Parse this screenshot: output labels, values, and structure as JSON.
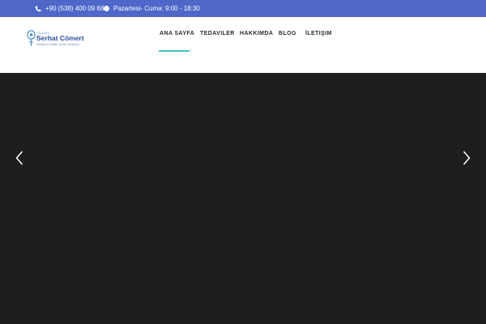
{
  "topbar": {
    "phone": "+90 (538) 400 09 68",
    "hours": "Pazartesi- Cuma: 9:00 - 18:30",
    "background": "#4e67c9"
  },
  "logo": {
    "small": "OLUDU",
    "name": "Serhat Cömert",
    "tagline": "Medikal ve Estetik Cerrahi Teknisyeni"
  },
  "nav": {
    "items": [
      {
        "label": "ANA SAYFA",
        "active": true
      },
      {
        "label": "TEDAVILER"
      },
      {
        "label": "HAKKIMDA"
      },
      {
        "label": "BLOG"
      },
      {
        "label": "İLETIŞIM"
      }
    ],
    "accent": "#40c3c3"
  },
  "hero": {
    "background": "#1e1e1e",
    "prev_icon": "chevron-left-icon",
    "next_icon": "chevron-right-icon"
  }
}
